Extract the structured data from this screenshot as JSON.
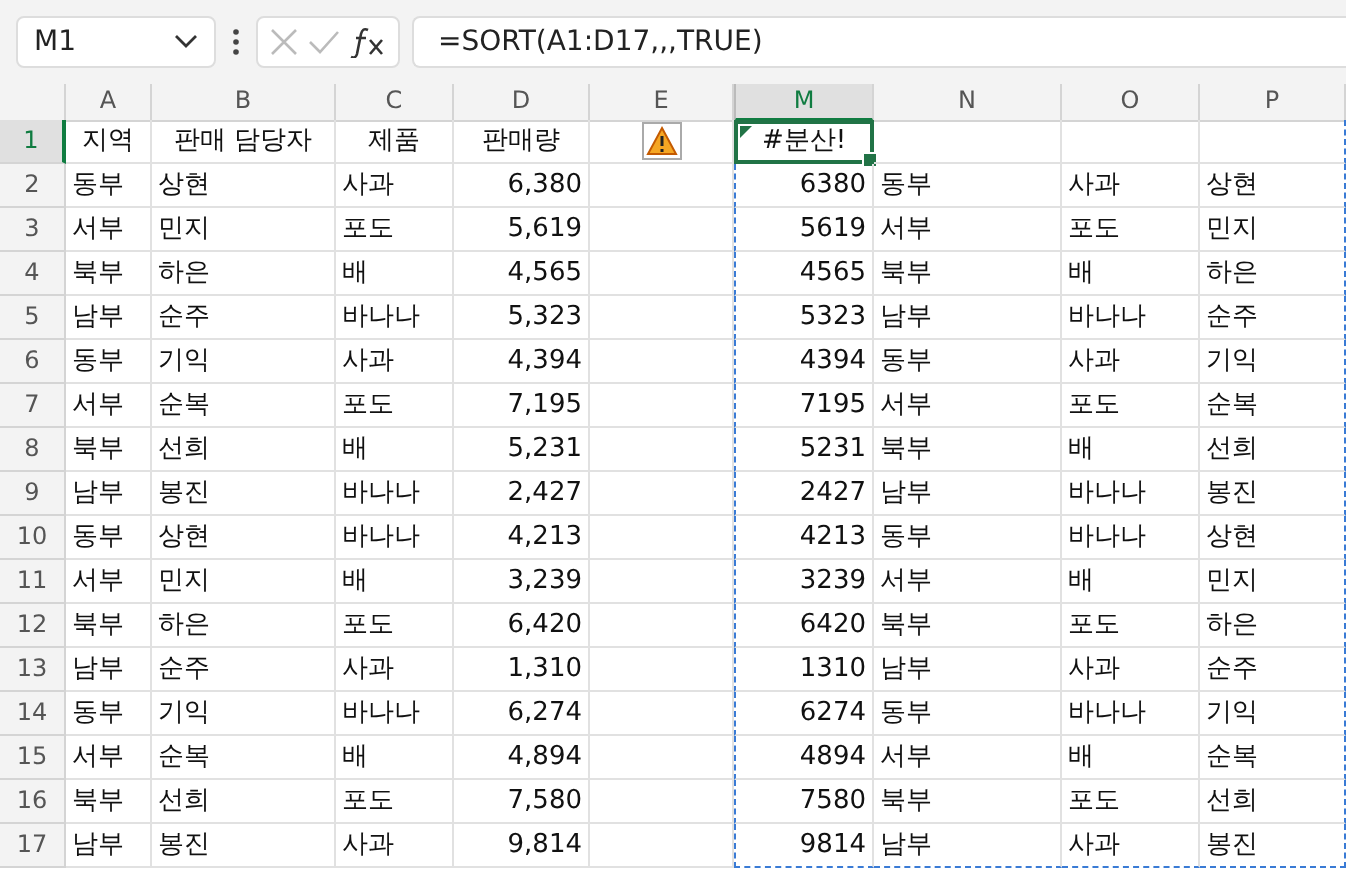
{
  "name_box": "M1",
  "formula": "=SORT(A1:D17,,,TRUE)",
  "columns": [
    {
      "label": "A",
      "selected": false
    },
    {
      "label": "B",
      "selected": false
    },
    {
      "label": "C",
      "selected": false
    },
    {
      "label": "D",
      "selected": false
    },
    {
      "label": "E",
      "selected": false
    },
    {
      "label": "M",
      "selected": true
    },
    {
      "label": "N",
      "selected": false
    },
    {
      "label": "O",
      "selected": false
    },
    {
      "label": "P",
      "selected": false
    }
  ],
  "rows": [
    {
      "num": "1",
      "selected": true,
      "cells": [
        "지역",
        "판매 담당자",
        "제품",
        "판매량"
      ],
      "spill": [
        "#분산!"
      ],
      "spill_selected": true,
      "warning": true
    },
    {
      "num": "2",
      "selected": false,
      "cells": [
        "동부",
        "상현",
        "사과",
        "6,380"
      ],
      "spill": [
        "6380",
        "동부",
        "사과",
        "상현"
      ]
    },
    {
      "num": "3",
      "selected": false,
      "cells": [
        "서부",
        "민지",
        "포도",
        "5,619"
      ],
      "spill": [
        "5619",
        "서부",
        "포도",
        "민지"
      ]
    },
    {
      "num": "4",
      "selected": false,
      "cells": [
        "북부",
        "하은",
        "배",
        "4,565"
      ],
      "spill": [
        "4565",
        "북부",
        "배",
        "하은"
      ]
    },
    {
      "num": "5",
      "selected": false,
      "cells": [
        "남부",
        "순주",
        "바나나",
        "5,323"
      ],
      "spill": [
        "5323",
        "남부",
        "바나나",
        "순주"
      ]
    },
    {
      "num": "6",
      "selected": false,
      "cells": [
        "동부",
        "기익",
        "사과",
        "4,394"
      ],
      "spill": [
        "4394",
        "동부",
        "사과",
        "기익"
      ]
    },
    {
      "num": "7",
      "selected": false,
      "cells": [
        "서부",
        "순복",
        "포도",
        "7,195"
      ],
      "spill": [
        "7195",
        "서부",
        "포도",
        "순복"
      ]
    },
    {
      "num": "8",
      "selected": false,
      "cells": [
        "북부",
        "선희",
        "배",
        "5,231"
      ],
      "spill": [
        "5231",
        "북부",
        "배",
        "선희"
      ]
    },
    {
      "num": "9",
      "selected": false,
      "cells": [
        "남부",
        "봉진",
        "바나나",
        "2,427"
      ],
      "spill": [
        "2427",
        "남부",
        "바나나",
        "봉진"
      ]
    },
    {
      "num": "10",
      "selected": false,
      "cells": [
        "동부",
        "상현",
        "바나나",
        "4,213"
      ],
      "spill": [
        "4213",
        "동부",
        "바나나",
        "상현"
      ]
    },
    {
      "num": "11",
      "selected": false,
      "cells": [
        "서부",
        "민지",
        "배",
        "3,239"
      ],
      "spill": [
        "3239",
        "서부",
        "배",
        "민지"
      ]
    },
    {
      "num": "12",
      "selected": false,
      "cells": [
        "북부",
        "하은",
        "포도",
        "6,420"
      ],
      "spill": [
        "6420",
        "북부",
        "포도",
        "하은"
      ]
    },
    {
      "num": "13",
      "selected": false,
      "cells": [
        "남부",
        "순주",
        "사과",
        "1,310"
      ],
      "spill": [
        "1310",
        "남부",
        "사과",
        "순주"
      ]
    },
    {
      "num": "14",
      "selected": false,
      "cells": [
        "동부",
        "기익",
        "바나나",
        "6,274"
      ],
      "spill": [
        "6274",
        "동부",
        "바나나",
        "기익"
      ]
    },
    {
      "num": "15",
      "selected": false,
      "cells": [
        "서부",
        "순복",
        "배",
        "4,894"
      ],
      "spill": [
        "4894",
        "서부",
        "배",
        "순복"
      ]
    },
    {
      "num": "16",
      "selected": false,
      "cells": [
        "북부",
        "선희",
        "포도",
        "7,580"
      ],
      "spill": [
        "7580",
        "북부",
        "포도",
        "선희"
      ]
    },
    {
      "num": "17",
      "selected": false,
      "cells": [
        "남부",
        "봉진",
        "사과",
        "9,814"
      ],
      "spill": [
        "9814",
        "남부",
        "사과",
        "봉진"
      ]
    }
  ]
}
